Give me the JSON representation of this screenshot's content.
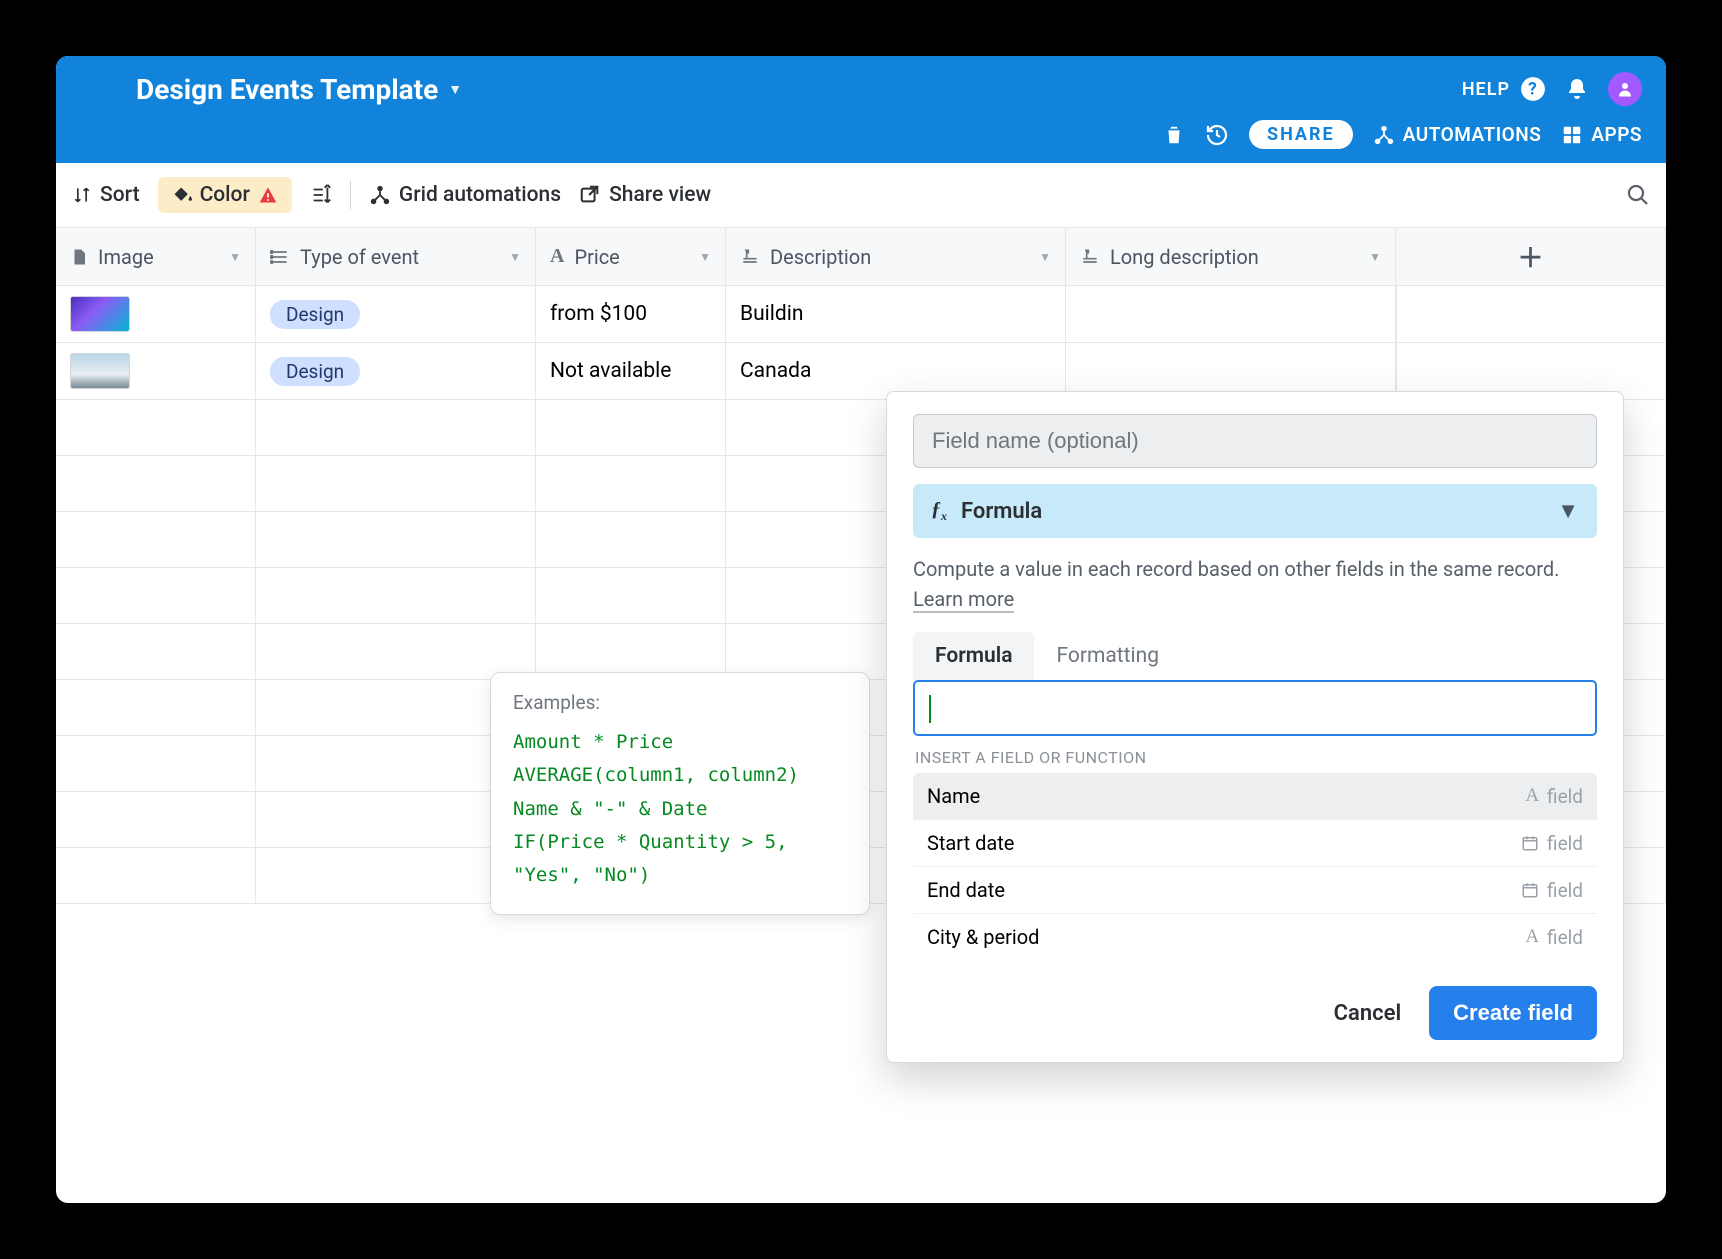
{
  "header": {
    "title": "Design Events Template",
    "help": "HELP",
    "share": "SHARE",
    "automations": "AUTOMATIONS",
    "apps": "APPS"
  },
  "toolbar": {
    "sort": "Sort",
    "color": "Color",
    "grid_automations": "Grid automations",
    "share_view": "Share view"
  },
  "columns": {
    "image": "Image",
    "type": "Type of event",
    "price": "Price",
    "description": "Description",
    "long_description": "Long description"
  },
  "rows": [
    {
      "tag": "Design",
      "price": "from $100",
      "description": "Buildin"
    },
    {
      "tag": "Design",
      "price": "Not available",
      "description": "Canada"
    }
  ],
  "tooltip": {
    "title": "Examples:",
    "body": "Amount * Price\nAVERAGE(column1, column2)\nName & \"-\" & Date\nIF(Price * Quantity > 5, \"Yes\", \"No\")"
  },
  "popover": {
    "field_name_placeholder": "Field name (optional)",
    "type_label": "Formula",
    "description": "Compute a value in each record based on other fields in the same record. ",
    "learn_more": "Learn more",
    "tabs": {
      "formula": "Formula",
      "formatting": "Formatting"
    },
    "section_label": "INSERT A FIELD OR FUNCTION",
    "fields": [
      {
        "name": "Name",
        "kind": "A",
        "kind_label": "field"
      },
      {
        "name": "Start date",
        "kind": "cal",
        "kind_label": "field"
      },
      {
        "name": "End date",
        "kind": "cal",
        "kind_label": "field"
      },
      {
        "name": "City & period",
        "kind": "A",
        "kind_label": "field"
      }
    ],
    "cancel": "Cancel",
    "create": "Create field"
  }
}
